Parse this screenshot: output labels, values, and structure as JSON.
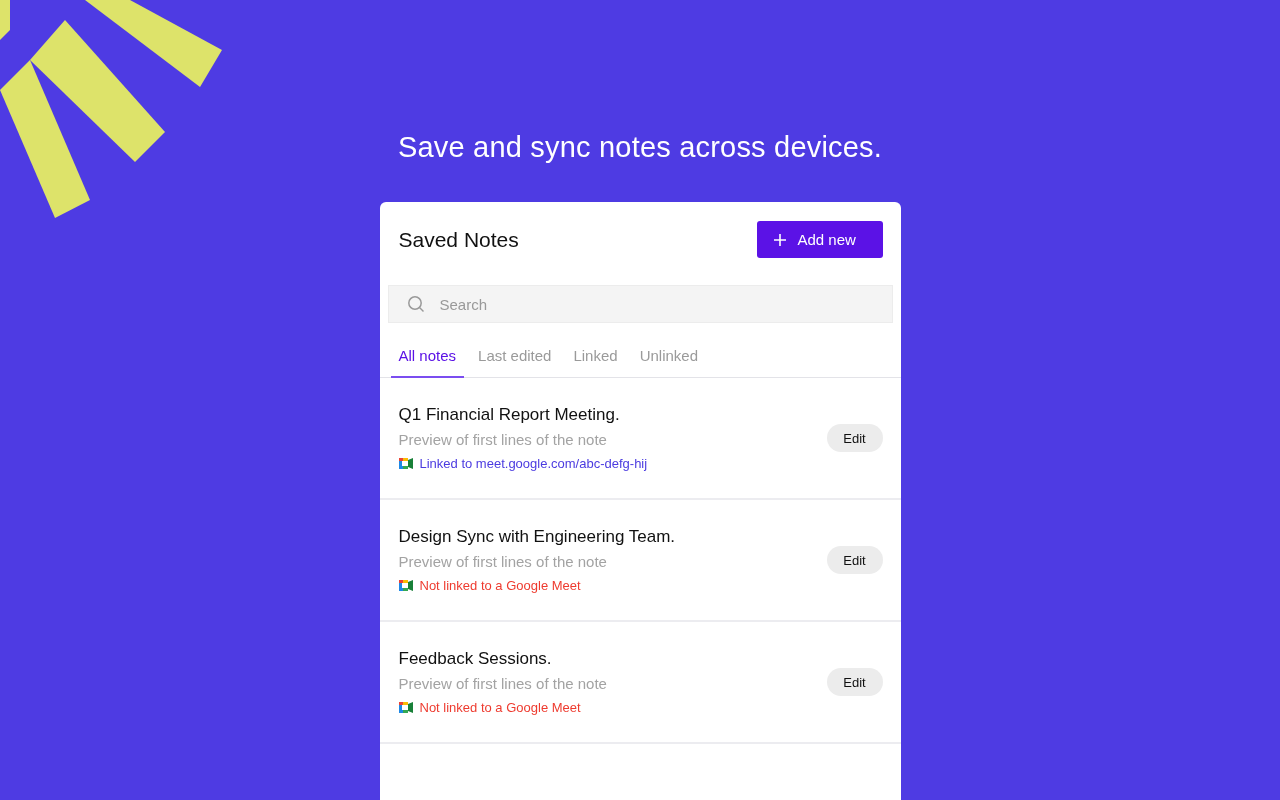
{
  "headline": "Save and sync notes across devices.",
  "panel": {
    "title": "Saved Notes",
    "add_button": "Add new",
    "search": {
      "placeholder": "Search"
    },
    "tabs": [
      {
        "label": "All notes",
        "selected": true
      },
      {
        "label": "Last edited",
        "selected": false
      },
      {
        "label": "Linked",
        "selected": false
      },
      {
        "label": "Unlinked",
        "selected": false
      }
    ],
    "notes": [
      {
        "title": "Q1 Financial Report Meeting.",
        "preview": "Preview of first lines of the note",
        "link_text": "Linked to meet.google.com/abc-defg-hij",
        "linked": true,
        "button": "Edit"
      },
      {
        "title": "Design Sync with Engineering Team.",
        "preview": "Preview of first lines of the note",
        "link_text": "Not linked to a Google Meet",
        "linked": false,
        "button": "Edit"
      },
      {
        "title": "Feedback Sessions.",
        "preview": "Preview of first lines of the note",
        "link_text": "Not linked to a Google Meet",
        "linked": false,
        "button": "Edit"
      }
    ]
  }
}
